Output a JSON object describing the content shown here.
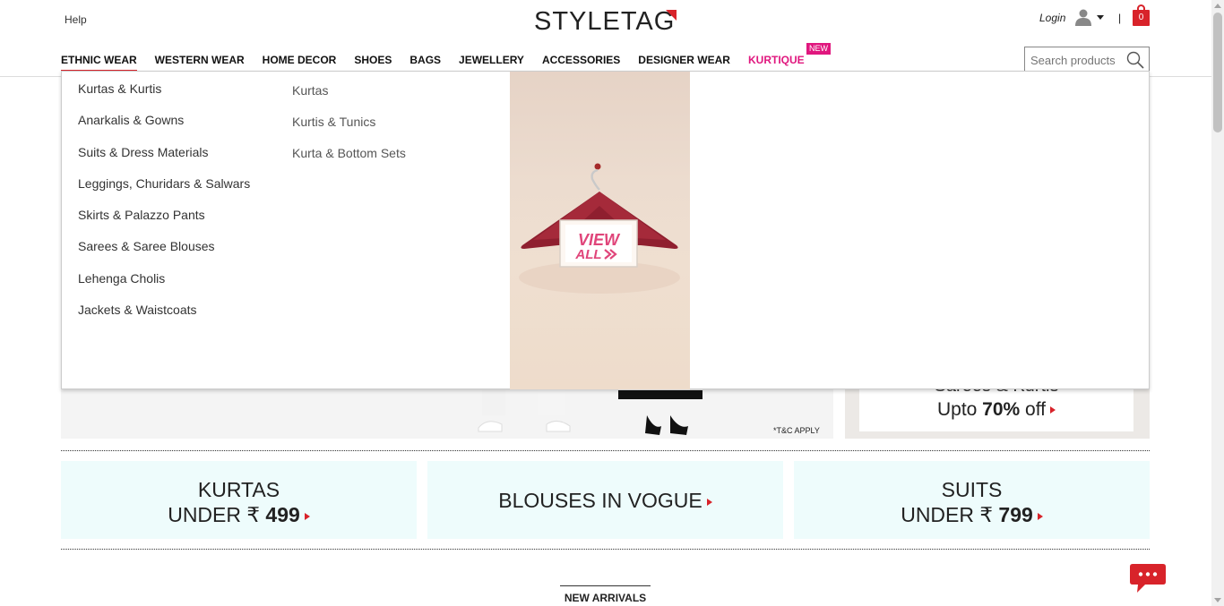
{
  "header": {
    "help_label": "Help",
    "logo_text": "STYLETAG",
    "login_label": "Login",
    "separator": "|",
    "cart_count": "0",
    "search_placeholder": "Search products"
  },
  "nav": {
    "items": [
      {
        "label": "ETHNIC WEAR",
        "active": true
      },
      {
        "label": "WESTERN WEAR"
      },
      {
        "label": "HOME DECOR"
      },
      {
        "label": "SHOES"
      },
      {
        "label": "BAGS"
      },
      {
        "label": "JEWELLERY"
      },
      {
        "label": "ACCESSORIES"
      },
      {
        "label": "DESIGNER WEAR"
      },
      {
        "label": "KURTIQUE",
        "badge": "NEW"
      }
    ]
  },
  "mega_menu": {
    "column1": [
      "Kurtas & Kurtis",
      "Anarkalis & Gowns",
      "Suits & Dress Materials",
      "Leggings, Churidars & Salwars",
      "Skirts & Palazzo Pants",
      "Sarees & Saree Blouses",
      "Lehenga Cholis",
      "Jackets & Waistcoats"
    ],
    "column2": [
      "Kurtas",
      "Kurtis & Tunics",
      "Kurta & Bottom Sets"
    ],
    "banner": {
      "line1": "VIEW",
      "line2": "ALL"
    }
  },
  "hero": {
    "tnc": "*T&C APPLY",
    "right_line1": "Sarees & Kurtis",
    "right_line2_prefix": "Upto ",
    "right_line2_bold": "70%",
    "right_line2_suffix": " off"
  },
  "promos": {
    "kurtas_l1": "KURTAS",
    "kurtas_l2_prefix": "UNDER ₹ ",
    "kurtas_price": "499",
    "blouses": "BLOUSES IN VOGUE",
    "suits_l1": "SUITS",
    "suits_l2_prefix": "UNDER ₹ ",
    "suits_price": "799"
  },
  "section_title": "NEW ARRIVALS",
  "colors": {
    "brand_red": "#d8232a",
    "kurtique_pink": "#e0177e",
    "promo_bg": "#eefcfc"
  }
}
